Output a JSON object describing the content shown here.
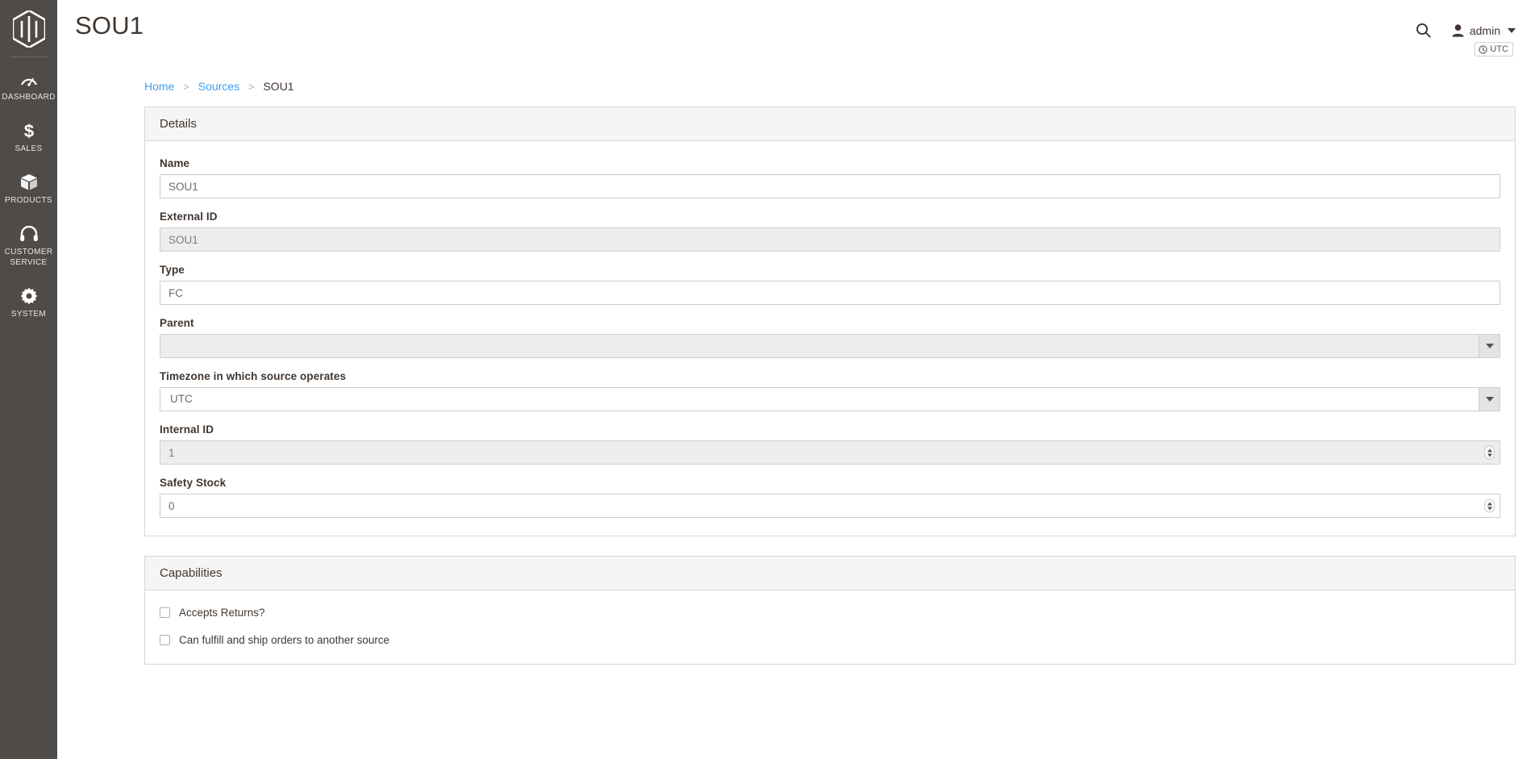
{
  "sidebar": {
    "logo_icon": "magento-logo-icon",
    "items": [
      {
        "label": "Dashboard",
        "icon": "dashboard-gauge-icon",
        "multiline": false
      },
      {
        "label": "Sales",
        "icon": "dollar-sign-icon",
        "multiline": false
      },
      {
        "label": "Products",
        "icon": "box-package-icon",
        "multiline": false
      },
      {
        "label": "Customer Service",
        "icon": "headset-icon",
        "multiline": true
      },
      {
        "label": "System",
        "icon": "gear-icon",
        "multiline": false
      }
    ]
  },
  "header": {
    "title": "SOU1",
    "search_icon": "search-icon",
    "admin_label": "admin",
    "admin_icon": "user-avatar-icon",
    "timezone_badge": "UTC",
    "clock_icon": "clock-icon"
  },
  "breadcrumb": {
    "items": [
      {
        "label": "Home",
        "link": true
      },
      {
        "label": "Sources",
        "link": true
      },
      {
        "label": "SOU1",
        "link": false
      }
    ],
    "separator": ">"
  },
  "details_panel": {
    "title": "Details",
    "fields": {
      "name": {
        "label": "Name",
        "value": "SOU1",
        "disabled": false
      },
      "external_id": {
        "label": "External ID",
        "value": "SOU1",
        "disabled": true
      },
      "type": {
        "label": "Type",
        "value": "FC",
        "disabled": false
      },
      "parent": {
        "label": "Parent",
        "value": "",
        "disabled": true
      },
      "timezone": {
        "label": "Timezone in which source operates",
        "value": "UTC",
        "disabled": false
      },
      "internal_id": {
        "label": "Internal ID",
        "value": "1",
        "disabled": true
      },
      "safety_stock": {
        "label": "Safety Stock",
        "value": "0",
        "disabled": false
      }
    }
  },
  "capabilities_panel": {
    "title": "Capabilities",
    "checkboxes": [
      {
        "label": "Accepts Returns?",
        "checked": false
      },
      {
        "label": "Can fulfill and ship orders to another source",
        "checked": false
      }
    ]
  },
  "colors": {
    "sidebar_bg": "#4f4b48",
    "link_blue": "#3f9ff0",
    "text_dark": "#41362f",
    "panel_header_bg": "#f5f5f5",
    "disabled_bg": "#ededed"
  }
}
